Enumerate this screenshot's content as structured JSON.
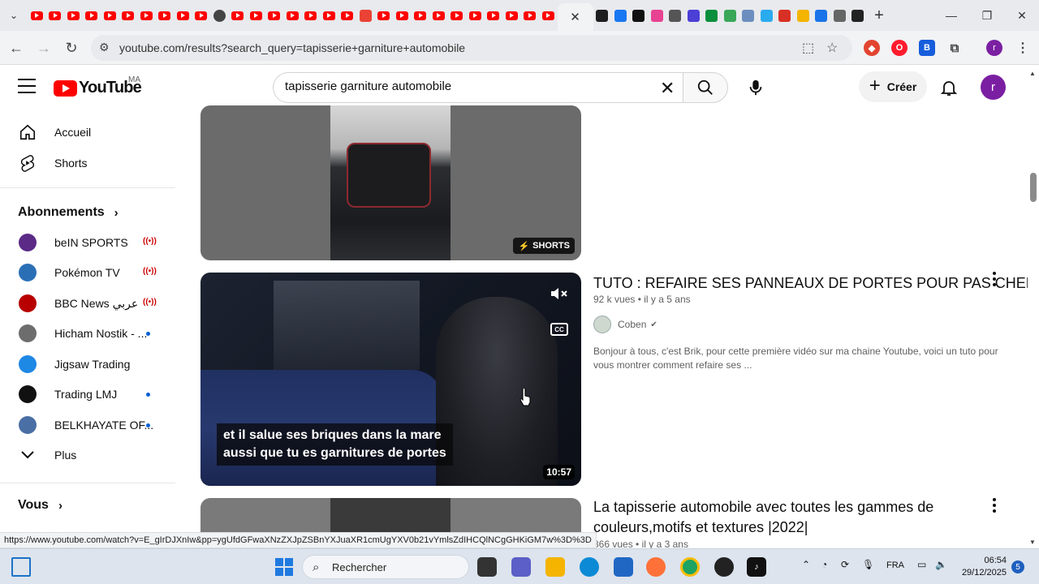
{
  "browser": {
    "url": "youtube.com/results?search_query=tapisserie+garniture+automobile",
    "status_url": "https://www.youtube.com/watch?v=E_gIrDJXnIw&pp=ygUfdGFwaXNzZXJpZSBnYXJuaXR1cmUgYXV0b21vYmlsZdIHCQlNCgGHKiGM7w%3D%3D",
    "profile_initial": "r",
    "window": {
      "minimize": "—",
      "maximize": "❐",
      "close": "✕"
    }
  },
  "youtube": {
    "logo_text": "YouTube",
    "country_code": "MA",
    "search_query": "tapisserie garniture automobile",
    "create_label": "Créer",
    "avatar_initial": "r"
  },
  "sidebar": {
    "home": "Accueil",
    "shorts": "Shorts",
    "subscriptions_header": "Abonnements",
    "subscriptions": [
      {
        "name": "beIN SPORTS",
        "indicator": "live",
        "avatar_color": "#5b2a86"
      },
      {
        "name": "Pokémon TV",
        "indicator": "live",
        "avatar_color": "#2a6fb5"
      },
      {
        "name": "BBC News عربي",
        "indicator": "live",
        "avatar_color": "#b80000"
      },
      {
        "name": "Hicham Nostik - ...",
        "indicator": "new",
        "avatar_color": "#6d6d6d"
      },
      {
        "name": "Jigsaw Trading",
        "indicator": "none",
        "avatar_color": "#1e88e5"
      },
      {
        "name": "Trading LMJ",
        "indicator": "new",
        "avatar_color": "#111111"
      },
      {
        "name": "BELKHAYATE OF...",
        "indicator": "new",
        "avatar_color": "#4a6fa5"
      }
    ],
    "more": "Plus",
    "you_header": "Vous"
  },
  "results": [
    {
      "badge": "SHORTS"
    },
    {
      "title": "TUTO : REFAIRE SES PANNEAUX DE PORTES POUR PAS CHER",
      "views": "92 k vues",
      "age": "il y a 5 ans",
      "channel": "Coben",
      "verified": true,
      "description": "Bonjour à tous, c'est Brik, pour cette première vidéo sur ma chaine Youtube, voici un tuto pour vous montrer comment refaire ses ...",
      "caption_line1": "et il salue ses briques dans la mare",
      "caption_line2": "aussi que tu es garnitures de portes",
      "duration": "10:57",
      "cc_label": "CC"
    },
    {
      "title_line1": "La tapisserie automobile avec toutes les gammes de",
      "title_line2": "couleurs,motifs et textures |2022|",
      "views": "866 vues",
      "age": "il y a 3 ans"
    }
  ],
  "taskbar": {
    "search_placeholder": "Rechercher",
    "language": "FRA",
    "time": "06:54",
    "date": "29/12/2025",
    "notifications": "5"
  },
  "colors": {
    "youtube_red": "#ff0000",
    "avatar_purple": "#7b1fa2",
    "live_red": "#cc0000",
    "new_dot_blue": "#065fd4"
  }
}
